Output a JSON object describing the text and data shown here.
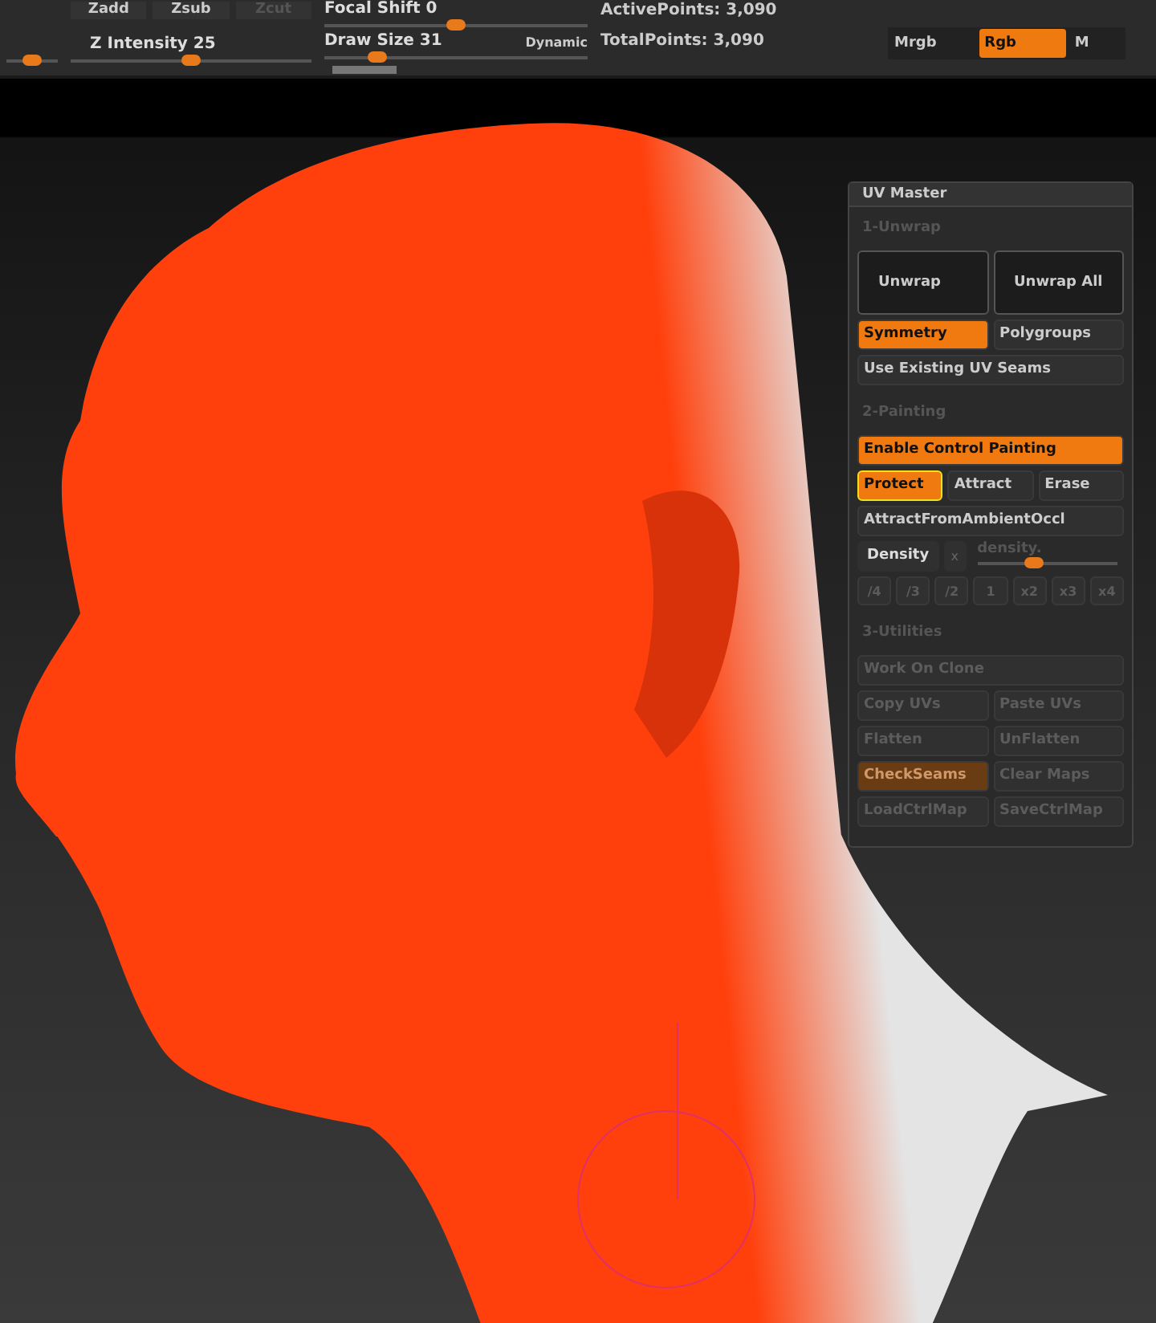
{
  "toolbar": {
    "buttons": [
      {
        "label": "Zadd",
        "disabled": false
      },
      {
        "label": "Zsub",
        "disabled": false
      },
      {
        "label": "Zcut",
        "disabled": true
      }
    ],
    "focal_shift": {
      "label": "Focal Shift 0",
      "level": 0.5
    },
    "z_intensity": {
      "label": "Z Intensity 25",
      "level": 0.5
    },
    "left_slider": {
      "level": 0.5
    },
    "draw_size": {
      "label": "Draw Size 31",
      "level": 0.2
    },
    "dynamic": "Dynamic",
    "active_points": "ActivePoints: 3,090",
    "total_points": "TotalPoints: 3,090",
    "color_modes": [
      {
        "label": "Mrgb",
        "selected": false
      },
      {
        "label": "Rgb",
        "selected": true
      },
      {
        "label": "M",
        "selected": false
      }
    ]
  },
  "panel": {
    "title": "UV Master",
    "sections": [
      {
        "title": "1-Unwrap",
        "rows": [
          {
            "kind": "buttons",
            "tall": true,
            "buttons": [
              {
                "label": "Unwrap",
                "selected": false,
                "disabled": false,
                "outlined": false
              },
              {
                "label": "Unwrap All",
                "selected": false,
                "disabled": false,
                "outlined": false
              }
            ]
          },
          {
            "kind": "buttons",
            "buttons": [
              {
                "label": "Symmetry",
                "selected": true,
                "disabled": false,
                "outlined": false
              },
              {
                "label": "Polygroups",
                "selected": false,
                "disabled": false,
                "outlined": false
              }
            ]
          },
          {
            "kind": "buttons",
            "buttons": [
              {
                "label": "Use Existing UV Seams",
                "selected": false,
                "disabled": false,
                "outlined": false
              }
            ]
          }
        ]
      },
      {
        "title": "2-Painting",
        "rows": [
          {
            "kind": "buttons",
            "buttons": [
              {
                "label": "Enable Control Painting",
                "selected": true,
                "disabled": false,
                "outlined": false
              }
            ]
          },
          {
            "kind": "buttons",
            "buttons": [
              {
                "label": "Protect",
                "selected": true,
                "disabled": false,
                "outlined": true
              },
              {
                "label": "Attract",
                "selected": false,
                "disabled": false,
                "outlined": false
              },
              {
                "label": "Erase",
                "selected": false,
                "disabled": false,
                "outlined": false
              }
            ]
          },
          {
            "kind": "buttons",
            "buttons": [
              {
                "label": "AttractFromAmbientOccl",
                "selected": false,
                "disabled": false,
                "outlined": false
              }
            ]
          },
          {
            "kind": "density",
            "label": "Density",
            "x": "x",
            "slider_label": "density.",
            "level": 0.4
          },
          {
            "kind": "buttons",
            "small": true,
            "buttons": [
              {
                "label": "/4",
                "selected": false,
                "disabled": true,
                "outlined": false
              },
              {
                "label": "/3",
                "selected": false,
                "disabled": true,
                "outlined": false
              },
              {
                "label": "/2",
                "selected": false,
                "disabled": true,
                "outlined": false
              },
              {
                "label": "1",
                "selected": false,
                "disabled": true,
                "outlined": false
              },
              {
                "label": "x2",
                "selected": false,
                "disabled": true,
                "outlined": false
              },
              {
                "label": "x3",
                "selected": false,
                "disabled": true,
                "outlined": false
              },
              {
                "label": "x4",
                "selected": false,
                "disabled": true,
                "outlined": false
              }
            ]
          }
        ]
      },
      {
        "title": "3-Utilities",
        "rows": [
          {
            "kind": "buttons",
            "buttons": [
              {
                "label": "Work On Clone",
                "selected": false,
                "disabled": true,
                "outlined": false
              }
            ]
          },
          {
            "kind": "buttons",
            "buttons": [
              {
                "label": "Copy UVs",
                "selected": false,
                "disabled": true,
                "outlined": false
              },
              {
                "label": "Paste UVs",
                "selected": false,
                "disabled": true,
                "outlined": false
              }
            ]
          },
          {
            "kind": "buttons",
            "buttons": [
              {
                "label": "Flatten",
                "selected": false,
                "disabled": true,
                "outlined": false
              },
              {
                "label": "UnFlatten",
                "selected": false,
                "disabled": true,
                "outlined": false
              }
            ]
          },
          {
            "kind": "buttons",
            "buttons": [
              {
                "label": "CheckSeams",
                "selected": true,
                "disabled": true,
                "outlined": false
              },
              {
                "label": "Clear Maps",
                "selected": false,
                "disabled": true,
                "outlined": false
              }
            ]
          },
          {
            "kind": "buttons",
            "buttons": [
              {
                "label": "LoadCtrlMap",
                "selected": false,
                "disabled": true,
                "outlined": false
              },
              {
                "label": "SaveCtrlMap",
                "selected": false,
                "disabled": true,
                "outlined": false
              }
            ]
          }
        ]
      }
    ]
  }
}
